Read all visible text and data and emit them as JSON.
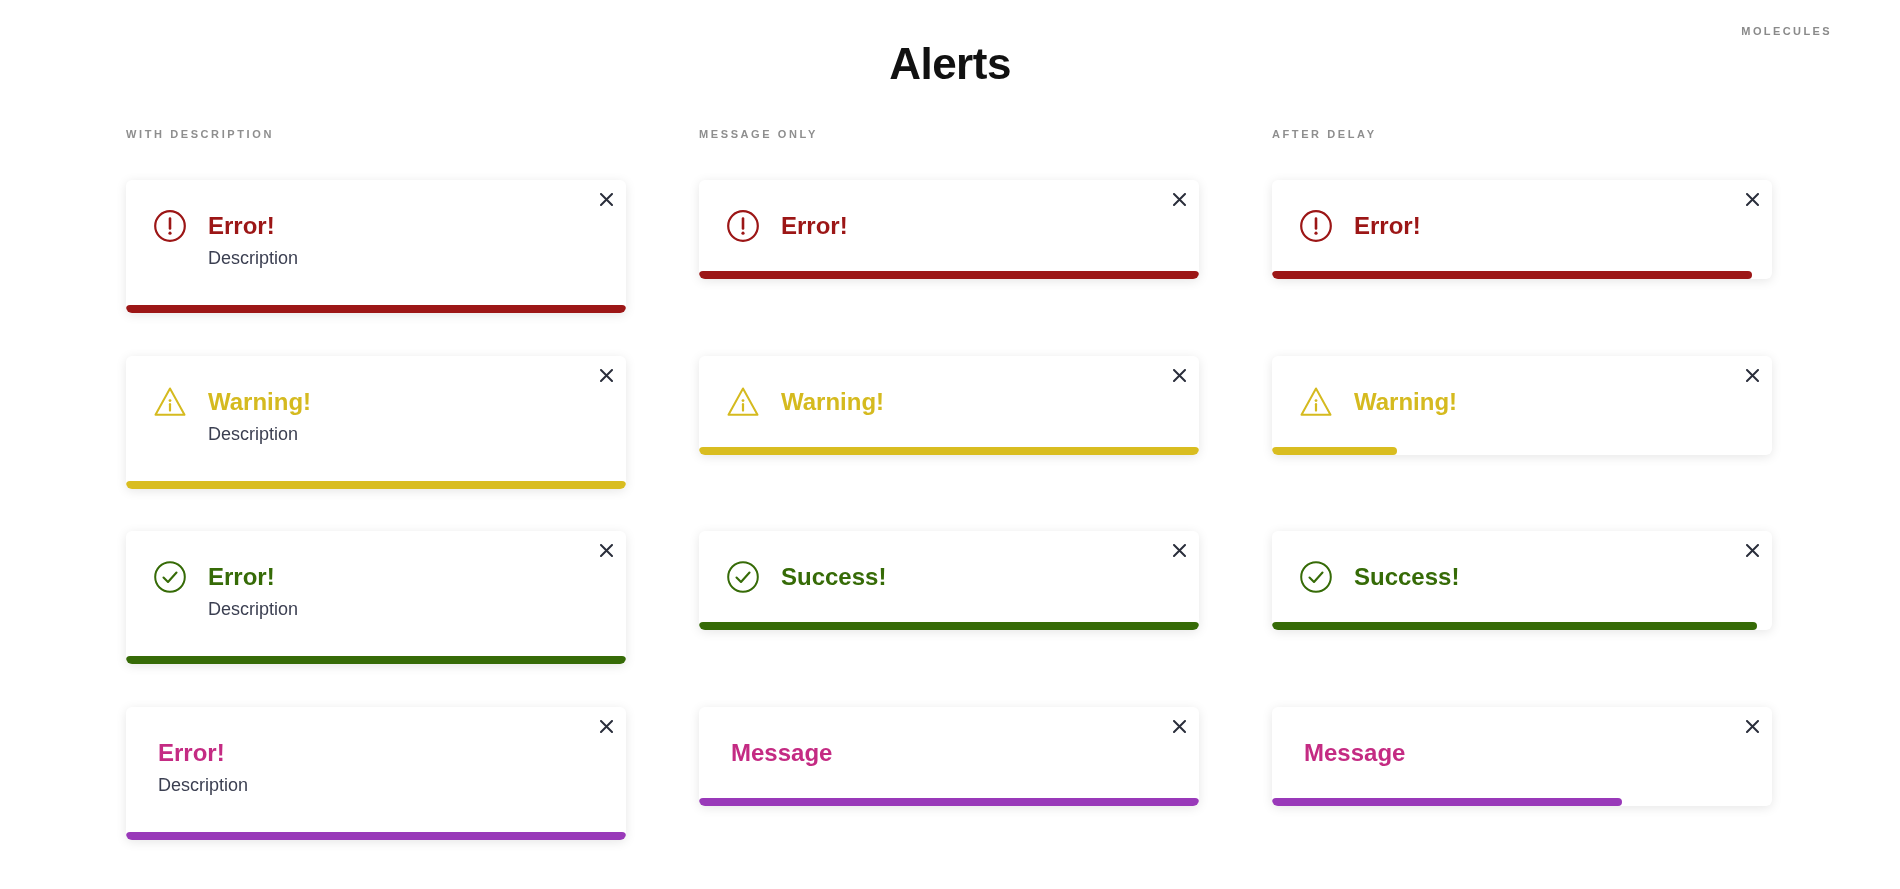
{
  "header": {
    "category": "MOLECULES",
    "title": "Alerts"
  },
  "sections": [
    {
      "label": "WITH DESCRIPTION",
      "alerts": [
        {
          "kind": "error",
          "title": "Error!",
          "description": "Description",
          "level": 1
        },
        {
          "kind": "warning",
          "title": "Warning!",
          "description": "Description",
          "level": 1
        },
        {
          "kind": "success",
          "title": "Error!",
          "description": "Description",
          "level": 1
        },
        {
          "kind": "message",
          "title": "Error!",
          "description": "Description",
          "level": 1
        }
      ]
    },
    {
      "label": "MESSAGE ONLY",
      "alerts": [
        {
          "kind": "error",
          "title": "Error!",
          "level": 1
        },
        {
          "kind": "warning",
          "title": "Warning!",
          "level": 1
        },
        {
          "kind": "success",
          "title": "Success!",
          "level": 1
        },
        {
          "kind": "message",
          "title": "Message",
          "level": 1
        }
      ]
    },
    {
      "label": "AFTER DELAY",
      "alerts": [
        {
          "kind": "error",
          "title": "Error!",
          "level": 0.96
        },
        {
          "kind": "warning",
          "title": "Warning!",
          "level": 0.25
        },
        {
          "kind": "success",
          "title": "Success!",
          "level": 0.97
        },
        {
          "kind": "message",
          "title": "Message",
          "level": 0.7
        }
      ]
    }
  ]
}
